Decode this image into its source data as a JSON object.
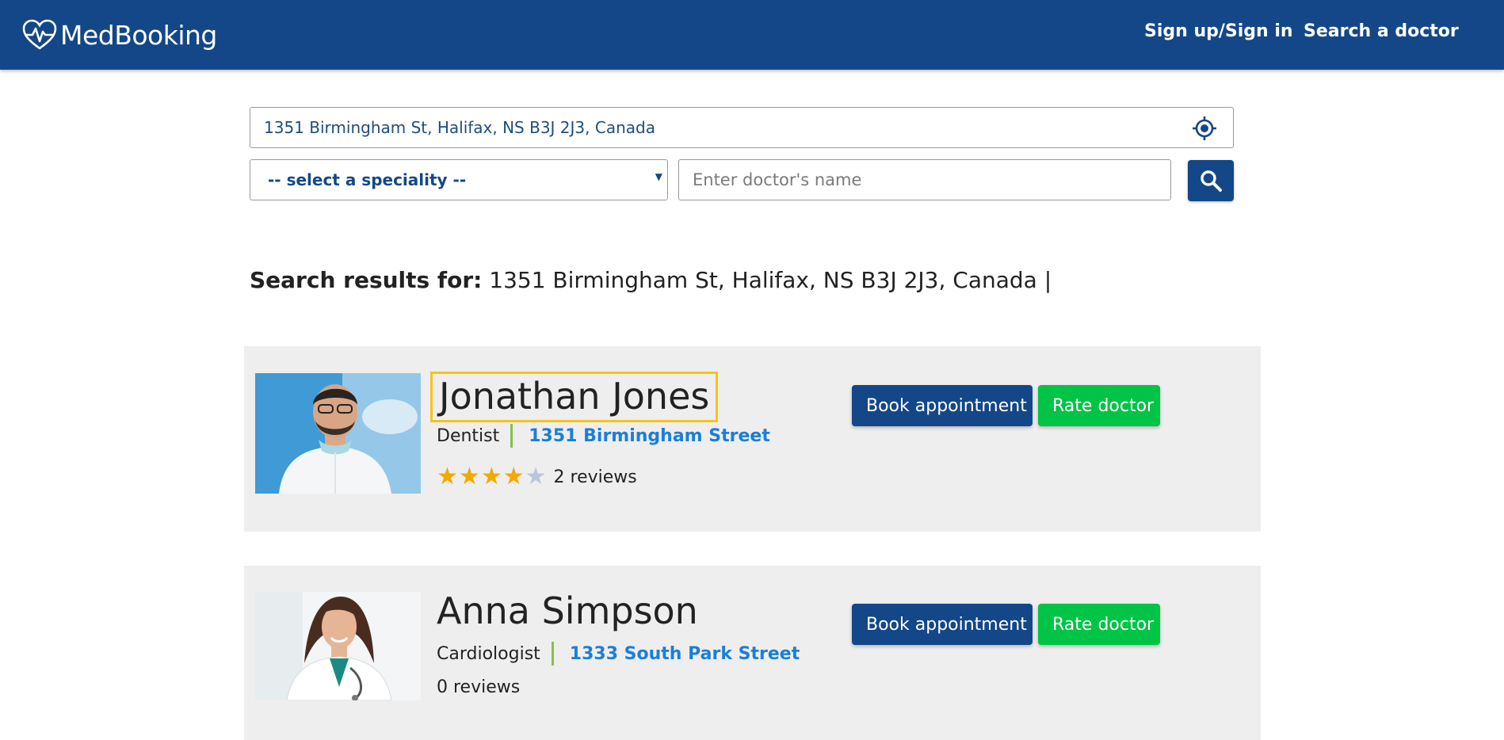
{
  "header": {
    "brand": "MedBooking",
    "logo_icon": "heart-pulse-icon",
    "nav": {
      "signin": "Sign up/Sign in",
      "search": "Search a doctor"
    }
  },
  "search": {
    "address_value": "1351 Birmingham St, Halifax, NS B3J 2J3, Canada",
    "locate_icon": "crosshair-locate-icon",
    "speciality_selected": "-- select a speciality --",
    "doctor_name_placeholder": "Enter doctor's name",
    "search_icon": "magnifier-icon"
  },
  "results": {
    "label": "Search results for:",
    "query": "1351 Birmingham St, Halifax, NS B3J 2J3, Canada |"
  },
  "doctors": [
    {
      "name": "Jonathan Jones",
      "speciality": "Dentist",
      "address": "1351 Birmingham Street",
      "rating": 4,
      "rating_max": 5,
      "reviews": "2 reviews",
      "book_label": "Book appointment",
      "rate_label": "Rate doctor"
    },
    {
      "name": "Anna Simpson",
      "speciality": "Cardiologist",
      "address": "1333 South Park Street",
      "reviews": "0 reviews",
      "book_label": "Book appointment",
      "rate_label": "Rate doctor"
    }
  ],
  "colors": {
    "primary": "#134788",
    "success": "#00c445",
    "link": "#1b7fd6",
    "star": "#f2a900",
    "highlight": "#f5c31c"
  }
}
